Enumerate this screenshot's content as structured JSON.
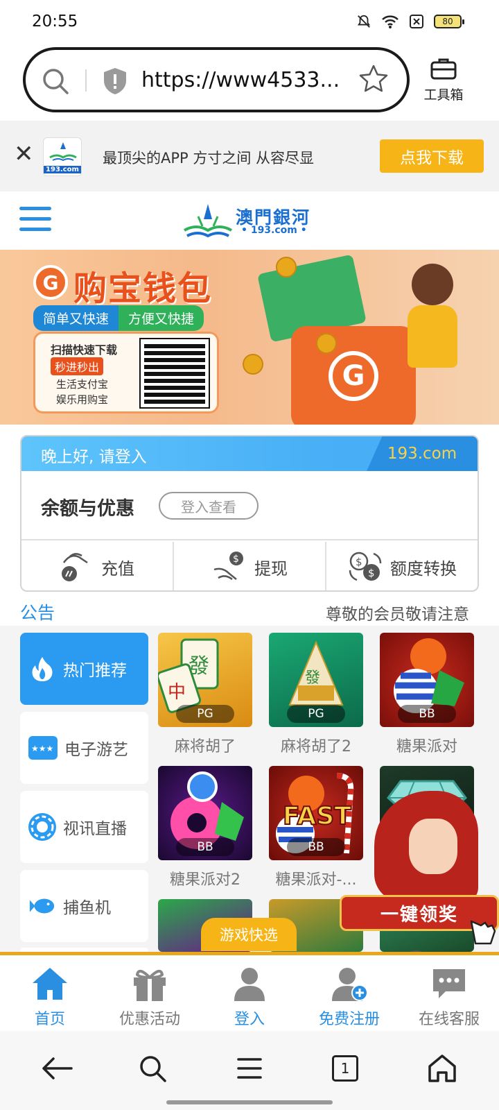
{
  "status_bar": {
    "time": "20:55",
    "battery": "80"
  },
  "browser": {
    "url": "https://www4533...",
    "toolbox_label": "工具箱"
  },
  "download_banner": {
    "logo_text": "193.com",
    "slogan": "最顶尖的APP 方寸之间 从容尽显",
    "button": "点我下载"
  },
  "site_header": {
    "logo_name": "澳門銀河",
    "logo_domain": "• 193.com •"
  },
  "promo": {
    "title": "购宝钱包",
    "tag1": "简单又快速",
    "tag2": "方便又快捷",
    "line1": "扫描快速下载",
    "line2": "秒进秒出",
    "line3": "生活支付宝",
    "line4": "娱乐用购宝",
    "colors": {
      "orange": "#e8501c",
      "blue": "#1e88d6",
      "green": "#2fb15a"
    }
  },
  "account": {
    "greeting": "晚上好, 请登入",
    "domain": "193.com",
    "balance_label": "余额与优惠",
    "login_view": "登入查看",
    "actions": [
      {
        "label": "充值",
        "icon": "hand-card-icon"
      },
      {
        "label": "提现",
        "icon": "hand-dollar-icon"
      },
      {
        "label": "额度转换",
        "icon": "dollar-exchange-icon"
      }
    ]
  },
  "notice": {
    "label": "公告",
    "text": "尊敬的会员敬请注意"
  },
  "categories": [
    {
      "label": "热门推荐",
      "icon": "flame-icon",
      "active": true
    },
    {
      "label": "电子游艺",
      "icon": "slot-icon",
      "active": false
    },
    {
      "label": "视讯直播",
      "icon": "chip-icon",
      "active": false
    },
    {
      "label": "捕鱼机",
      "icon": "fish-icon",
      "active": false
    }
  ],
  "games": [
    {
      "name": "麻将胡了",
      "provider": "PG"
    },
    {
      "name": "麻将胡了2",
      "provider": "PG"
    },
    {
      "name": "糖果派对",
      "provider": "BB"
    },
    {
      "name": "糖果派对2",
      "provider": "BB"
    },
    {
      "name": "糖果派对-...",
      "provider": "BB"
    }
  ],
  "quick_pick": "游戏快选",
  "float_banner": {
    "label": "一键领奖",
    "close": "✕"
  },
  "tabbar": [
    {
      "label": "首页",
      "icon": "home-icon"
    },
    {
      "label": "优惠活动",
      "icon": "gift-icon"
    },
    {
      "label": "登入",
      "icon": "user-icon"
    },
    {
      "label": "免费注册",
      "icon": "user-add-icon"
    },
    {
      "label": "在线客服",
      "icon": "chat-icon"
    }
  ],
  "browser_nav": {
    "tab_count": "1"
  }
}
